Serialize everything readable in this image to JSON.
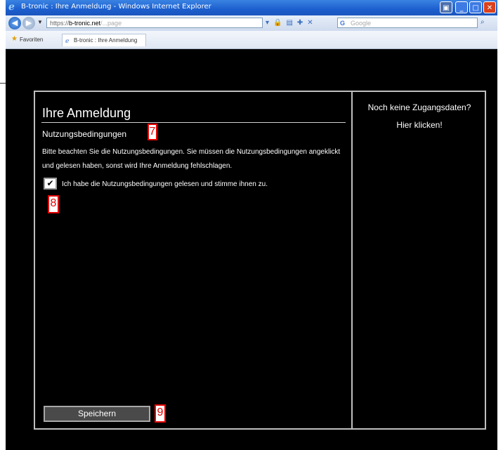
{
  "browser": {
    "window_title": "B-tronic : Ihre Anmeldung - Windows Internet Explorer",
    "address": {
      "prefix": "https://",
      "host": "b-tronic.net",
      "path": "/...page"
    },
    "search_placeholder": "Google",
    "favorites_label": "Favoriten",
    "tab_label": "B-tronic : Ihre Anmeldung"
  },
  "form": {
    "title": "Ihre Anmeldung",
    "section_title": "Nutzungsbedingungen",
    "info_text": "Bitte beachten Sie die Nutzungsbedingungen. Sie müssen die Nutzungsbedingungen angeklickt und gelesen haben, sonst wird Ihre Anmeldung fehlschlagen.",
    "checkbox_checked": true,
    "checkbox_label": "Ich habe die Nutzungsbedingungen gelesen und stimme ihnen zu.",
    "save_label": "Speichern"
  },
  "sidebar": {
    "title": "Noch keine Zugangsdaten?",
    "link": "Hier klicken!"
  },
  "markers": {
    "m7": "7",
    "m8": "8",
    "m9": "9"
  },
  "colors": {
    "page_bg": "#000000",
    "marker": "#e60000",
    "titlebar": "#1c5fce"
  }
}
